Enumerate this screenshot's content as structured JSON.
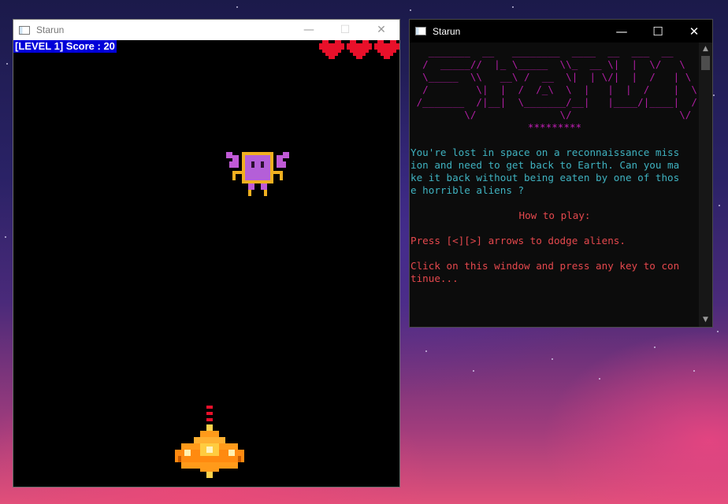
{
  "game_window": {
    "title": "Starun",
    "hud_text": "[LEVEL 1] Score : 20",
    "lives": 3,
    "controls": {
      "minimize": "—",
      "maximize": "☐",
      "close": "✕"
    }
  },
  "console_window": {
    "title": "Starun",
    "controls": {
      "minimize": "—",
      "maximize": "☐",
      "close": "✕"
    },
    "ascii_art": "   _______  __   ________  ____  __  ___  __\n  /  _____//  |_ \\_____  \\\\_  __ \\|  |  \\/   \\\n  \\_____  \\\\   __\\ /  __  \\|  | \\/|  |  /   | \\\n  /        \\|  |  /  /_\\  \\  |   |  |  /    |  \\\n /_______  /|__|  \\_______/__|   |____/|____|  /\n         \\/              \\/                  \\/",
    "stars": "*********",
    "intro": "You're lost in space on a reconnaissance miss\nion and need to get back to Earth. Can you ma\nke it back without being eaten by one of thos\ne horrible aliens ?",
    "how_to_play": "How to play:",
    "instruction_arrows": "Press [<][>] arrows to dodge aliens.",
    "instruction_continue": "Click on this window and press any key to con\ntinue..."
  },
  "colors": {
    "hud_bg": "#0000d8",
    "heart": "#e8102a",
    "console_magenta": "#b01ea3",
    "console_cyan": "#3fb2c0",
    "console_red": "#e5484d"
  }
}
